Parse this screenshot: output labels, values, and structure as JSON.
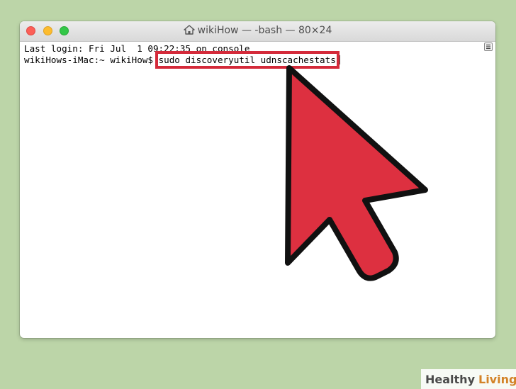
{
  "window": {
    "title": "wikiHow — -bash — 80×24",
    "controls": [
      "close",
      "minimize",
      "zoom"
    ]
  },
  "terminal": {
    "line1": "Last login: Fri Jul  1 09:22:35 on console",
    "prompt": "wikiHows-iMac:~ wikiHow$ ",
    "command": "sudo discoveryutil udnscachestats"
  },
  "annotation": {
    "highlight_color": "#d42a3a",
    "arrow_color": "#dd3040",
    "icon": "pointer-arrow-icon"
  },
  "watermark": {
    "part1": "Healthy",
    "part2": "Living"
  },
  "colors": {
    "background": "#bcd5a8"
  }
}
